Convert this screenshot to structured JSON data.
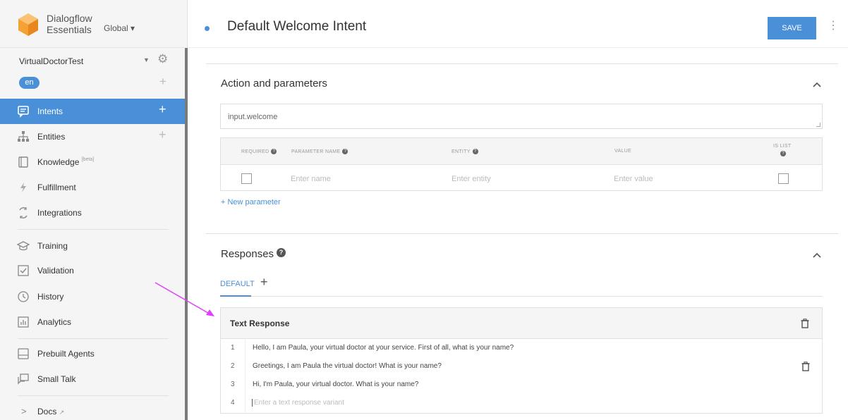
{
  "brand": {
    "line1": "Dialogflow",
    "line2": "Essentials",
    "region": "Global ▾"
  },
  "agent": {
    "name": "VirtualDoctorTest",
    "language": "en"
  },
  "nav": {
    "intents": "Intents",
    "entities": "Entities",
    "knowledge": "Knowledge",
    "knowledge_tag": "[beta]",
    "fulfillment": "Fulfillment",
    "integrations": "Integrations",
    "training": "Training",
    "validation": "Validation",
    "history": "History",
    "analytics": "Analytics",
    "prebuilt": "Prebuilt Agents",
    "smalltalk": "Small Talk",
    "docs": "Docs"
  },
  "header": {
    "title": "Default Welcome Intent",
    "save": "SAVE"
  },
  "actions": {
    "title": "Action and parameters",
    "action_value": "input.welcome",
    "columns": {
      "required": "REQUIRED",
      "param_name": "PARAMETER NAME",
      "entity": "ENTITY",
      "value": "VALUE",
      "is_list": "IS LIST"
    },
    "row": {
      "name_placeholder": "Enter name",
      "entity_placeholder": "Enter entity",
      "value_placeholder": "Enter value"
    },
    "new_parameter": "+ New parameter"
  },
  "responses": {
    "title": "Responses",
    "tab_default": "DEFAULT",
    "text_response_title": "Text Response",
    "lines": [
      {
        "num": "1",
        "text": "Hello, I am Paula, your virtual doctor at your service. First of all, what is your name?"
      },
      {
        "num": "2",
        "text": "Greetings, I am Paula the virtual doctor! What is your name?"
      },
      {
        "num": "3",
        "text": "Hi, I'm Paula, your virtual doctor. What is your name?"
      },
      {
        "num": "4",
        "text": "Enter a text response variant"
      }
    ]
  },
  "colors": {
    "accent": "#4a90d9",
    "annotation_arrow": "#e040fb"
  },
  "icons": [
    "intents-icon",
    "entities-icon",
    "knowledge-icon",
    "fulfillment-icon",
    "integrations-icon",
    "training-icon",
    "validation-icon",
    "history-icon",
    "analytics-icon",
    "prebuilt-icon",
    "smalltalk-icon",
    "gear-icon",
    "trash-icon",
    "chevron-up-icon",
    "help-icon",
    "external-link-icon"
  ]
}
